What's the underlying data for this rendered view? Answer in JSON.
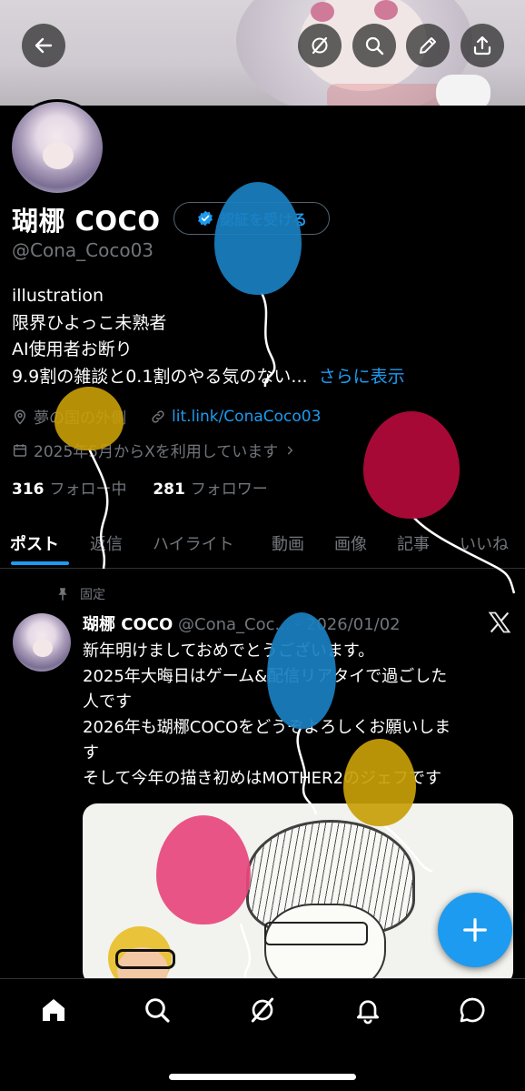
{
  "profile": {
    "display_name": "瑚梛 COCO",
    "handle": "@Cona_Coco03",
    "verify_button": "認証を受ける",
    "bio_lines": [
      "illustration",
      "限界ひよっこ未熟者",
      "AI使用者お断り",
      "9.9割の雑談と0.1割のやる気のない..."
    ],
    "bio_more": "さらに表示",
    "location": "夢の国の外側",
    "website": "lit.link/ConaCoco03",
    "joined": "2025年5月からXを利用しています",
    "following_count": "316",
    "following_label": "フォロー中",
    "followers_count": "281",
    "followers_label": "フォロワー"
  },
  "header_buttons": {
    "back": "back-arrow-icon",
    "grok": "grok-icon",
    "search": "search-icon",
    "edit": "pencil-icon",
    "share": "share-icon"
  },
  "tabs": [
    "ポスト",
    "返信",
    "ハイライト",
    "動画",
    "画像",
    "記事",
    "いいね"
  ],
  "active_tab": "ポスト",
  "post": {
    "pinned_label": "固定",
    "author_name": "瑚梛 COCO",
    "author_handle": "@Cona_Coc...",
    "date": "· 2026/01/02",
    "lines": [
      "新年明けましておめでとうございます。",
      "2025年大晦日はゲーム&配信リアタイで過ごした",
      "人です",
      "2026年も瑚梛COCOをどうぞよろしくお願いしま",
      "す",
      "そして今年の描き初めはMOTHER2のジェフです"
    ]
  },
  "bottom_nav": [
    "home-icon",
    "search-icon",
    "grok-icon",
    "notifications-icon",
    "messages-icon"
  ],
  "colors": {
    "accent": "#1d9bf0",
    "background": "#000000",
    "muted": "#71767b",
    "balloon_blue": "#1a7fc0",
    "balloon_gold": "#c9a008",
    "balloon_red": "#b0093a",
    "balloon_pink": "#e8477d"
  }
}
